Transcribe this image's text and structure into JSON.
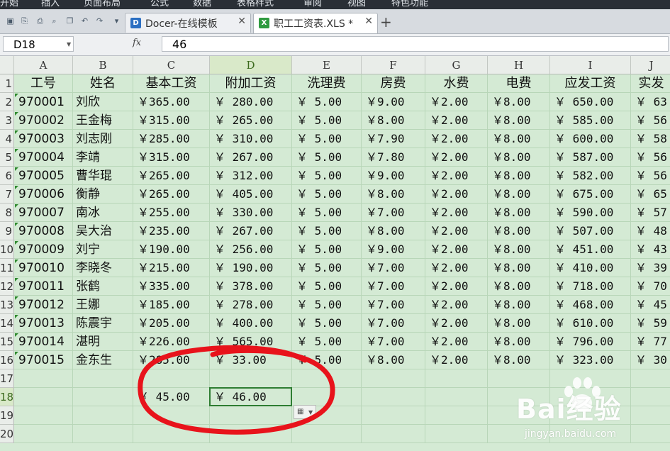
{
  "menu": [
    "开始",
    "插入",
    "页面布局",
    "公式",
    "数据",
    "表格样式",
    "审阅",
    "视图",
    "特色功能"
  ],
  "tabs": [
    {
      "label": "Docer-在线模板",
      "close": "✕",
      "icon": "docer-icon",
      "badge": "D",
      "color": "#2b6fc2"
    },
    {
      "label": "职工工资表.XLS *",
      "close": "✕",
      "icon": "excel-icon",
      "badge": "X",
      "color": "#2f9a3f"
    }
  ],
  "add_tab": "+",
  "formula": {
    "name_box": "D18",
    "fx": "fx",
    "value": "46"
  },
  "sheet": {
    "columns": [
      "A",
      "B",
      "C",
      "D",
      "E",
      "F",
      "G",
      "H",
      "I",
      "J"
    ],
    "selected_column": "D",
    "row_numbers": [
      "1",
      "2",
      "3",
      "4",
      "5",
      "6",
      "7",
      "8",
      "9",
      "10",
      "11",
      "12",
      "13",
      "14",
      "15",
      "16",
      "17",
      "18",
      "19",
      "20"
    ],
    "selected_row": "18",
    "headers": [
      "工号",
      "姓名",
      "基本工资",
      "附加工资",
      "洗理费",
      "房费",
      "水费",
      "电费",
      "应发工资",
      "实发"
    ],
    "rows": [
      [
        "970001",
        "刘欣",
        "￥365.00",
        "￥ 280.00",
        "￥ 5.00",
        "￥9.00",
        "￥2.00",
        "￥8.00",
        "￥ 650.00",
        "￥ 63"
      ],
      [
        "970002",
        "王金梅",
        "￥315.00",
        "￥ 265.00",
        "￥ 5.00",
        "￥8.00",
        "￥2.00",
        "￥8.00",
        "￥ 585.00",
        "￥ 56"
      ],
      [
        "970003",
        "刘志刚",
        "￥285.00",
        "￥ 310.00",
        "￥ 5.00",
        "￥7.90",
        "￥2.00",
        "￥8.00",
        "￥ 600.00",
        "￥ 58"
      ],
      [
        "970004",
        "李靖",
        "￥315.00",
        "￥ 267.00",
        "￥ 5.00",
        "￥7.80",
        "￥2.00",
        "￥8.00",
        "￥ 587.00",
        "￥ 56"
      ],
      [
        "970005",
        "曹华琨",
        "￥265.00",
        "￥ 312.00",
        "￥ 5.00",
        "￥9.00",
        "￥2.00",
        "￥8.00",
        "￥ 582.00",
        "￥ 56"
      ],
      [
        "970006",
        "衡静",
        "￥265.00",
        "￥ 405.00",
        "￥ 5.00",
        "￥8.00",
        "￥2.00",
        "￥8.00",
        "￥ 675.00",
        "￥ 65"
      ],
      [
        "970007",
        "南冰",
        "￥255.00",
        "￥ 330.00",
        "￥ 5.00",
        "￥7.00",
        "￥2.00",
        "￥8.00",
        "￥ 590.00",
        "￥ 57"
      ],
      [
        "970008",
        "吴大治",
        "￥235.00",
        "￥ 267.00",
        "￥ 5.00",
        "￥8.00",
        "￥2.00",
        "￥8.00",
        "￥ 507.00",
        "￥ 48"
      ],
      [
        "970009",
        "刘宁",
        "￥190.00",
        "￥ 256.00",
        "￥ 5.00",
        "￥9.00",
        "￥2.00",
        "￥8.00",
        "￥ 451.00",
        "￥ 43"
      ],
      [
        "970010",
        "李晓冬",
        "￥215.00",
        "￥ 190.00",
        "￥ 5.00",
        "￥7.00",
        "￥2.00",
        "￥8.00",
        "￥ 410.00",
        "￥ 39"
      ],
      [
        "970011",
        "张鹤",
        "￥335.00",
        "￥ 378.00",
        "￥ 5.00",
        "￥7.00",
        "￥2.00",
        "￥8.00",
        "￥ 718.00",
        "￥ 70"
      ],
      [
        "970012",
        "王娜",
        "￥185.00",
        "￥ 278.00",
        "￥ 5.00",
        "￥7.00",
        "￥2.00",
        "￥8.00",
        "￥ 468.00",
        "￥ 45"
      ],
      [
        "970013",
        "陈震宇",
        "￥205.00",
        "￥ 400.00",
        "￥ 5.00",
        "￥7.00",
        "￥2.00",
        "￥8.00",
        "￥ 610.00",
        "￥ 59"
      ],
      [
        "970014",
        "湛明",
        "￥226.00",
        "￥ 565.00",
        "￥ 5.00",
        "￥7.00",
        "￥2.00",
        "￥8.00",
        "￥ 796.00",
        "￥ 77"
      ],
      [
        "970015",
        "金东生",
        "￥285.00",
        "￥  33.00",
        "￥ 5.00",
        "￥8.00",
        "￥2.00",
        "￥8.00",
        "￥ 323.00",
        "￥ 30"
      ]
    ],
    "row18": {
      "C": "￥ 45.00",
      "D": "￥  46.00"
    }
  },
  "paste_options_icon": "paste-options-icon",
  "annotation_color": "#e8131b",
  "watermark": {
    "logo": "Bai经验",
    "url": "jingyan.baidu.com"
  }
}
